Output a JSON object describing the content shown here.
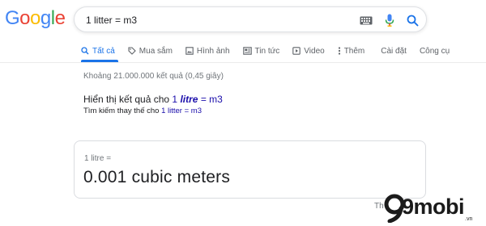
{
  "logo": {
    "letters": [
      "G",
      "o",
      "o",
      "g",
      "l",
      "e"
    ],
    "colors": [
      "#4285F4",
      "#EA4335",
      "#FBBC05",
      "#4285F4",
      "#34A853",
      "#EA4335"
    ]
  },
  "search": {
    "value": "1 litter = m3"
  },
  "tabs": [
    {
      "label": "Tất cả",
      "icon": "search-icon",
      "active": true
    },
    {
      "label": "Mua sắm",
      "icon": "tag-icon"
    },
    {
      "label": "Hình ảnh",
      "icon": "image-icon"
    },
    {
      "label": "Tin tức",
      "icon": "news-icon"
    },
    {
      "label": "Video",
      "icon": "play-icon"
    },
    {
      "label": "Thêm",
      "icon": "more-vert-icon"
    },
    {
      "label": "Cài đặt"
    },
    {
      "label": "Công cụ"
    }
  ],
  "results_stats": "Khoảng 21.000.000 kết quả (0,45 giây)",
  "spelling": {
    "showing_prefix": "Hiển thị kết quả cho",
    "corrected_number": "1",
    "corrected_word": "litre",
    "corrected_rest": "= m3",
    "instead_prefix": "Tìm kiếm thay thế cho",
    "instead_link": "1 litter = m3"
  },
  "answer_card": {
    "sub": "1 litre =",
    "main": "0.001 cubic meters"
  },
  "watermark": {
    "text": "9mobi",
    "sub": ".vn",
    "cut_text": "Th"
  },
  "colors": {
    "accent": "#1a73e8",
    "link": "#1a0dab",
    "muted": "#70757a",
    "mic_blue": "#4285F4",
    "mic_red": "#EA4335"
  }
}
